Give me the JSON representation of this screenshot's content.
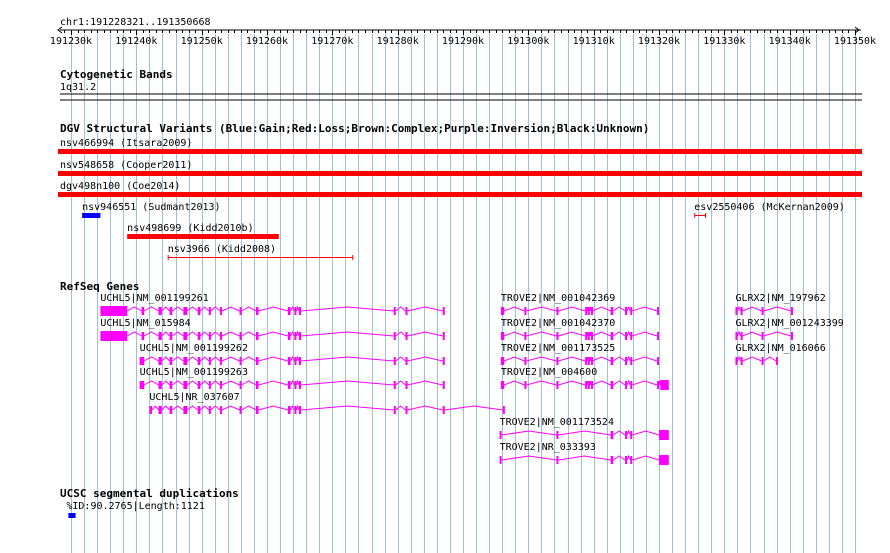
{
  "region": "chr1:191228321..191350668",
  "ruler": {
    "start": 191230000,
    "end": 191350000,
    "step": 10000,
    "ticks": [
      "191230k",
      "191240k",
      "191250k",
      "191260k",
      "191270k",
      "191280k",
      "191290k",
      "191300k",
      "191310k",
      "191320k",
      "191330k",
      "191340k",
      "191350k"
    ]
  },
  "tracks": {
    "cytoband": {
      "title": "Cytogenetic Bands",
      "band": "1q31.2"
    },
    "dgv": {
      "title": "DGV Structural Variants (Blue:Gain;Red:Loss;Brown:Complex;Purple:Inversion;Black:Unknown)",
      "features": [
        {
          "label": "nsv466994 (Itsara2009)",
          "start": 191228321,
          "end": 191350668,
          "color": "#ff0000",
          "style": "bar",
          "row": 0
        },
        {
          "label": "nsv548658 (Cooper2011)",
          "start": 191228321,
          "end": 191350668,
          "color": "#ff0000",
          "style": "bar",
          "row": 1
        },
        {
          "label": "dgv498n100 (Coe2014)",
          "start": 191228321,
          "end": 191350668,
          "color": "#ff0000",
          "style": "bar",
          "row": 2
        },
        {
          "label": "nsv946551 (Sudmant2013)",
          "start": 191231700,
          "end": 191234500,
          "color": "#0000ff",
          "style": "bar",
          "row": 3
        },
        {
          "label": "esv2550406 (McKernan2009)",
          "start": 191325400,
          "end": 191327200,
          "color": "#ff0000",
          "style": "line",
          "row": 3
        },
        {
          "label": "nsv498699 (Kidd2010b)",
          "start": 191238600,
          "end": 191261800,
          "color": "#ff0000",
          "style": "bar",
          "row": 4
        },
        {
          "label": "nsv3966 (Kidd2008)",
          "start": 191244800,
          "end": 191273200,
          "color": "#ff0000",
          "style": "line",
          "row": 5
        }
      ]
    },
    "refseq": {
      "title": "RefSeq Genes",
      "genes": [
        {
          "label": "UCHL5|NM_001199261",
          "row": 0,
          "start": 191234500,
          "end": 191287200,
          "strand": "-",
          "exons": [
            [
              191234500,
              191238600
            ],
            [
              191240800,
              191241200
            ],
            [
              191243400,
              191243900
            ],
            [
              191245100,
              191245500
            ],
            [
              191247200,
              191247800
            ],
            [
              191249400,
              191249800
            ],
            [
              191251100,
              191251400
            ],
            [
              191252800,
              191253100
            ],
            [
              191255800,
              191256100
            ],
            [
              191258300,
              191258700
            ],
            [
              191263200,
              191263600
            ],
            [
              191264200,
              191264500
            ],
            [
              191264900,
              191265200
            ],
            [
              191279400,
              191279700
            ],
            [
              191281200,
              191281500
            ],
            [
              191286900,
              191287200
            ]
          ]
        },
        {
          "label": "TROVE2|NM_001042369",
          "row": 0,
          "start": 191295800,
          "end": 191320000,
          "strand": "+",
          "exons": [
            [
              191295800,
              191296300
            ],
            [
              191299400,
              191299700
            ],
            [
              191304300,
              191304600
            ],
            [
              191308700,
              191308900
            ],
            [
              191309100,
              191309400
            ],
            [
              191309600,
              191309800
            ],
            [
              191312600,
              191313000
            ],
            [
              191314800,
              191315100
            ],
            [
              191315600,
              191315900
            ],
            [
              191319700,
              191320000
            ]
          ]
        },
        {
          "label": "GLRX2|NM_197962",
          "row": 0,
          "start": 191331700,
          "end": 191340500,
          "strand": "-",
          "exons": [
            [
              191331700,
              191332000
            ],
            [
              191332500,
              191332800
            ],
            [
              191335700,
              191336000
            ],
            [
              191340200,
              191340500
            ]
          ]
        },
        {
          "label": "UCHL5|NM_015984",
          "row": 1,
          "start": 191234500,
          "end": 191287200,
          "strand": "-",
          "exons": [
            [
              191234500,
              191238600
            ],
            [
              191240800,
              191241200
            ],
            [
              191243400,
              191243900
            ],
            [
              191245100,
              191245500
            ],
            [
              191247200,
              191247800
            ],
            [
              191249400,
              191249800
            ],
            [
              191251100,
              191251400
            ],
            [
              191252800,
              191253100
            ],
            [
              191255800,
              191256100
            ],
            [
              191258300,
              191258700
            ],
            [
              191263200,
              191263600
            ],
            [
              191264200,
              191264500
            ],
            [
              191264900,
              191265200
            ],
            [
              191279400,
              191279700
            ],
            [
              191281200,
              191281500
            ],
            [
              191286900,
              191287200
            ]
          ]
        },
        {
          "label": "TROVE2|NM_001042370",
          "row": 1,
          "start": 191295800,
          "end": 191320000,
          "strand": "+",
          "exons": [
            [
              191295800,
              191296300
            ],
            [
              191299400,
              191299700
            ],
            [
              191304300,
              191304600
            ],
            [
              191308700,
              191308900
            ],
            [
              191309100,
              191309400
            ],
            [
              191309600,
              191309800
            ],
            [
              191312600,
              191313000
            ],
            [
              191314800,
              191315100
            ],
            [
              191315600,
              191315900
            ],
            [
              191319700,
              191320000
            ]
          ]
        },
        {
          "label": "GLRX2|NM_001243399",
          "row": 1,
          "start": 191331700,
          "end": 191340500,
          "strand": "-",
          "exons": [
            [
              191331700,
              191332000
            ],
            [
              191332500,
              191332800
            ],
            [
              191335700,
              191336000
            ],
            [
              191340200,
              191340500
            ]
          ]
        },
        {
          "label": "UCHL5|NM_001199262",
          "row": 2,
          "start": 191240500,
          "end": 191287200,
          "strand": "-",
          "exons": [
            [
              191240500,
              191241200
            ],
            [
              191243400,
              191243900
            ],
            [
              191245100,
              191245500
            ],
            [
              191247200,
              191247800
            ],
            [
              191249400,
              191249800
            ],
            [
              191251100,
              191251400
            ],
            [
              191252800,
              191253100
            ],
            [
              191255800,
              191256100
            ],
            [
              191258300,
              191258700
            ],
            [
              191263200,
              191263600
            ],
            [
              191264200,
              191264500
            ],
            [
              191264900,
              191265200
            ],
            [
              191279400,
              191279700
            ],
            [
              191281200,
              191281500
            ],
            [
              191286900,
              191287200
            ]
          ]
        },
        {
          "label": "TROVE2|NM_001173525",
          "row": 2,
          "start": 191295800,
          "end": 191320000,
          "strand": "+",
          "exons": [
            [
              191295800,
              191296300
            ],
            [
              191299400,
              191299700
            ],
            [
              191304300,
              191304600
            ],
            [
              191308700,
              191308900
            ],
            [
              191309100,
              191309400
            ],
            [
              191309600,
              191309800
            ],
            [
              191312600,
              191313000
            ],
            [
              191314800,
              191315100
            ],
            [
              191315600,
              191315900
            ],
            [
              191319700,
              191320000
            ]
          ]
        },
        {
          "label": "GLRX2|NM_016066",
          "row": 2,
          "start": 191331700,
          "end": 191338200,
          "strand": "-",
          "exons": [
            [
              191331700,
              191332000
            ],
            [
              191332500,
              191332800
            ],
            [
              191335700,
              191336000
            ],
            [
              191337900,
              191338200
            ]
          ]
        },
        {
          "label": "UCHL5|NM_001199263",
          "row": 3,
          "start": 191240500,
          "end": 191287200,
          "strand": "-",
          "exons": [
            [
              191240500,
              191241200
            ],
            [
              191243400,
              191243900
            ],
            [
              191245100,
              191245500
            ],
            [
              191247200,
              191247800
            ],
            [
              191249400,
              191249800
            ],
            [
              191251100,
              191251400
            ],
            [
              191252800,
              191253100
            ],
            [
              191255800,
              191256100
            ],
            [
              191258300,
              191258700
            ],
            [
              191263200,
              191263600
            ],
            [
              191264200,
              191264500
            ],
            [
              191264900,
              191265200
            ],
            [
              191279400,
              191279700
            ],
            [
              191281200,
              191281500
            ],
            [
              191286900,
              191287200
            ]
          ]
        },
        {
          "label": "TROVE2|NM_004600",
          "row": 3,
          "start": 191295800,
          "end": 191321500,
          "strand": "+",
          "exons": [
            [
              191295800,
              191296300
            ],
            [
              191299400,
              191299700
            ],
            [
              191304300,
              191304600
            ],
            [
              191308700,
              191308900
            ],
            [
              191309100,
              191309400
            ],
            [
              191309600,
              191309800
            ],
            [
              191312600,
              191313000
            ],
            [
              191314800,
              191315100
            ],
            [
              191315600,
              191315900
            ],
            [
              191319700,
              191320000
            ],
            [
              191320200,
              191321500
            ]
          ]
        },
        {
          "label": "UCHL5|NR_037607",
          "row": 4,
          "start": 191242000,
          "end": 191296400,
          "strand": "-",
          "exons": [
            [
              191242000,
              191242400
            ],
            [
              191243400,
              191243900
            ],
            [
              191245100,
              191245500
            ],
            [
              191247200,
              191247800
            ],
            [
              191249400,
              191249800
            ],
            [
              191251100,
              191251400
            ],
            [
              191252800,
              191253100
            ],
            [
              191255800,
              191256100
            ],
            [
              191258300,
              191258700
            ],
            [
              191263200,
              191263600
            ],
            [
              191264200,
              191264500
            ],
            [
              191264900,
              191265200
            ],
            [
              191279400,
              191279700
            ],
            [
              191281200,
              191281500
            ],
            [
              191286900,
              191287200
            ],
            [
              191296100,
              191296400
            ]
          ]
        },
        {
          "label": "TROVE2|NM_001173524",
          "row": 5,
          "start": 191295600,
          "end": 191321500,
          "strand": "+",
          "exons": [
            [
              191295600,
              191295900
            ],
            [
              191304300,
              191304600
            ],
            [
              191312600,
              191313000
            ],
            [
              191314800,
              191315100
            ],
            [
              191315600,
              191315900
            ],
            [
              191320000,
              191321500
            ]
          ]
        },
        {
          "label": "TROVE2|NR_033393",
          "row": 6,
          "start": 191295600,
          "end": 191321500,
          "strand": "+",
          "exons": [
            [
              191295600,
              191295900
            ],
            [
              191304300,
              191304600
            ],
            [
              191312600,
              191313000
            ],
            [
              191314800,
              191315100
            ],
            [
              191315600,
              191315900
            ],
            [
              191320000,
              191321500
            ]
          ]
        }
      ]
    },
    "segdup": {
      "title": "UCSC segmental duplications",
      "features": [
        {
          "label": "%ID:90.2765|Length:1121",
          "start": 191229600,
          "end": 191230700,
          "color": "#0000ff"
        }
      ]
    }
  },
  "colors": {
    "grid": "#9bc2dc",
    "gene": "#ff00ff",
    "ruler": "#000000"
  }
}
